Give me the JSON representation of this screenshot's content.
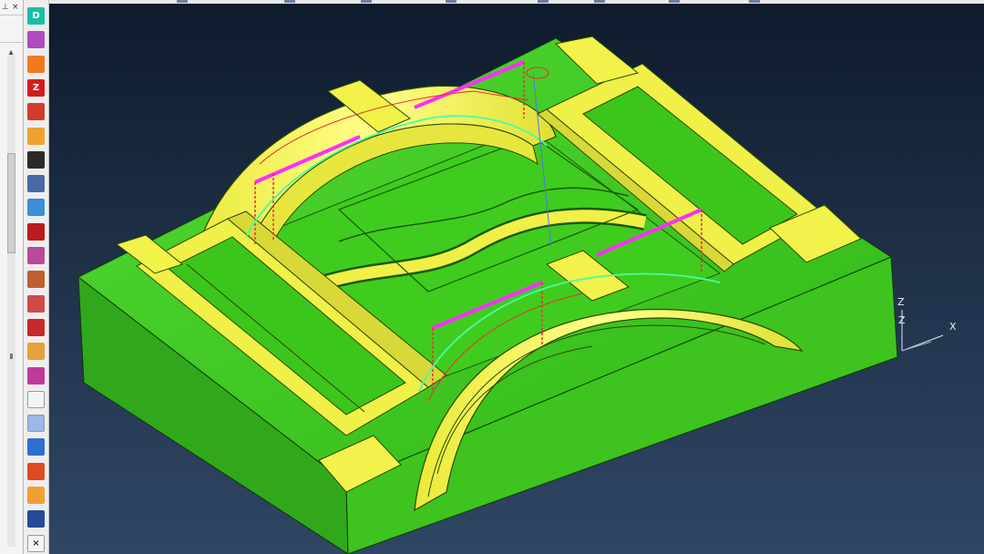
{
  "panel": {
    "pin": "⊥",
    "close": "×",
    "scroll_up": "▲"
  },
  "toolbar": {
    "items": [
      {
        "name": "design-icon",
        "label": "D",
        "color": "#16c0a8"
      },
      {
        "name": "tree-icon",
        "label": "",
        "color": "#b04cc0"
      },
      {
        "name": "paint-icon",
        "label": "",
        "color": "#ef7a20"
      },
      {
        "name": "z-level-icon",
        "label": "Z",
        "color": "#d21d1d"
      },
      {
        "name": "pattern-icon",
        "label": "",
        "color": "#d23c2c"
      },
      {
        "name": "block-icon",
        "label": "",
        "color": "#f0a030"
      },
      {
        "name": "head-icon",
        "label": "",
        "color": "#2a2a2a"
      },
      {
        "name": "tools-icon",
        "label": "",
        "color": "#4a6aa6"
      },
      {
        "name": "bulb-icon",
        "label": "",
        "color": "#3c8fd6"
      },
      {
        "name": "strategy-icon",
        "label": "",
        "color": "#b81c1c"
      },
      {
        "name": "mesh-icon",
        "label": "",
        "color": "#b84a9a"
      },
      {
        "name": "surface-icon",
        "label": "",
        "color": "#c06030"
      },
      {
        "name": "stop-icon",
        "label": "",
        "color": "#d04a4a"
      },
      {
        "name": "split-icon",
        "label": "",
        "color": "#c82828"
      },
      {
        "name": "cube-icon",
        "label": "",
        "color": "#e6a23a"
      },
      {
        "name": "texture-icon",
        "label": "",
        "color": "#c03a9a"
      },
      {
        "name": "sheet-icon",
        "label": "",
        "color": "#f4f4f4"
      },
      {
        "name": "pen-icon",
        "label": "",
        "color": "#9ab8e8"
      },
      {
        "name": "wire-icon",
        "label": "",
        "color": "#2f6fd0"
      },
      {
        "name": "fill-icon",
        "label": "",
        "color": "#e04a20"
      },
      {
        "name": "grid-icon",
        "label": "",
        "color": "#f0a032"
      },
      {
        "name": "select-icon",
        "label": "",
        "color": "#244a9a"
      },
      {
        "name": "close-icon",
        "label": "×",
        "color": "#f4f4f4"
      }
    ]
  },
  "viewport": {
    "axes": {
      "x_label": "X",
      "z_label": "Z",
      "z2_label": "Z"
    },
    "colors": {
      "part_green": "#38c81a",
      "part_yellow": "#f2f24a",
      "toolpath_magenta": "#ff2cff",
      "toolpath_red": "#e83030",
      "toolpath_green": "#46ffa0"
    }
  }
}
